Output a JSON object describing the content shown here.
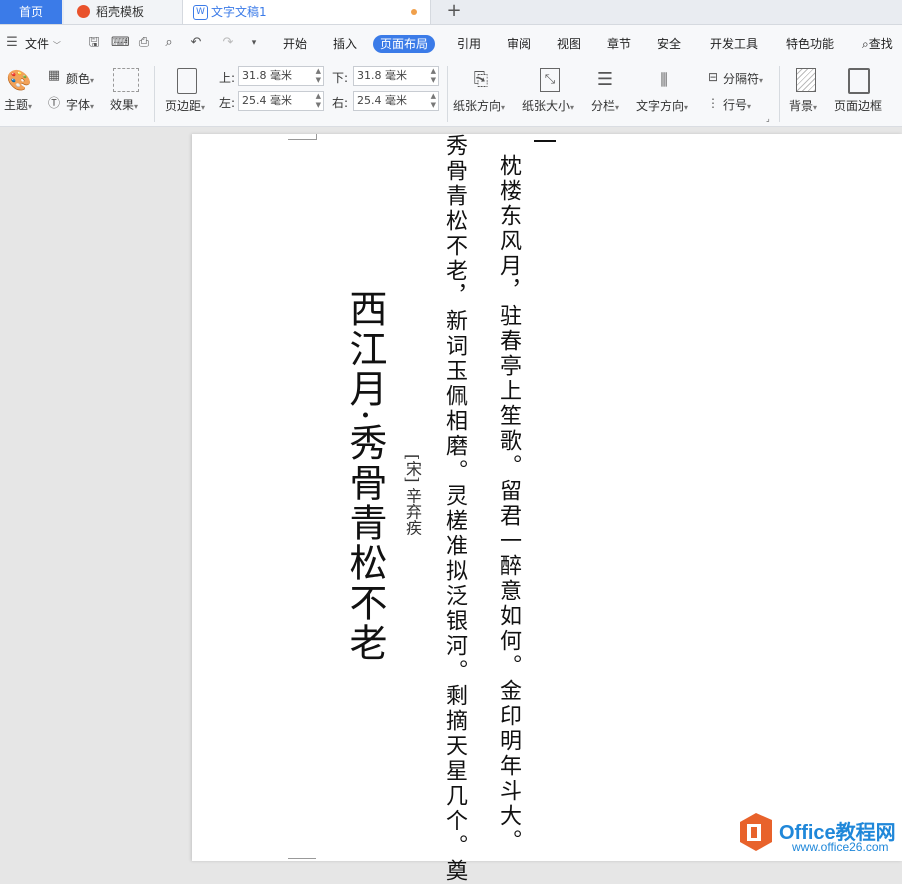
{
  "tabs": {
    "home": "首页",
    "templates": "稻壳模板",
    "document": "文字文稿1",
    "doc_icon": "W"
  },
  "menu": {
    "file": "文件",
    "items": [
      "开始",
      "插入",
      "页面布局",
      "引用",
      "审阅",
      "视图",
      "章节",
      "安全",
      "开发工具",
      "特色功能"
    ],
    "active": "页面布局",
    "find": "查找"
  },
  "ribbon": {
    "theme": "主题",
    "color": "颜色",
    "font": "字体",
    "effect": "效果",
    "margins": "页边距",
    "top_label": "上:",
    "top_value": "31.8 毫米",
    "bottom_label": "下:",
    "bottom_value": "31.8 毫米",
    "left_label": "左:",
    "left_value": "25.4 毫米",
    "right_label": "右:",
    "right_value": "25.4 毫米",
    "orientation": "纸张方向",
    "size": "纸张大小",
    "columns": "分栏",
    "text_direction": "文字方向",
    "breaks": "分隔符",
    "line_numbers": "行号",
    "background": "背景",
    "page_border": "页面边框"
  },
  "document": {
    "title": "西江月·秀骨青松不老",
    "author": "[宋] 辛弃疾",
    "line1": "秀骨青松不老，新词玉佩相磨。灵槎准拟泛银河。剩摘天星几个。奠",
    "line2": "枕楼东风月，驻春亭上笙歌。留君一醉意如何。金印明年斗大。"
  },
  "watermark": {
    "brand": "Office教程网",
    "url": "www.office26.com"
  },
  "colors": {
    "accent": "#3b7be8",
    "watermark": "#1f87d9",
    "logo": "#e8622b"
  }
}
